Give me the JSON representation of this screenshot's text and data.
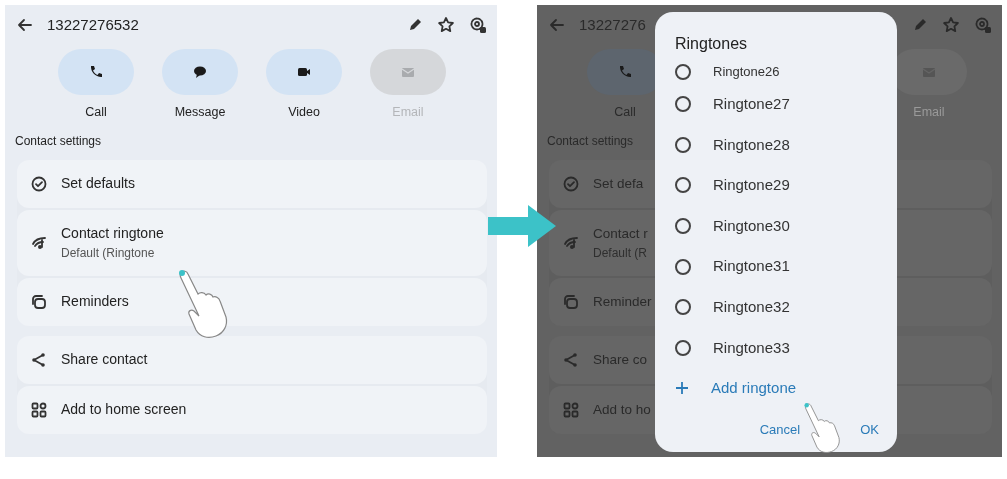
{
  "before_screen": {
    "header": {
      "title": "13227276532"
    },
    "actions": [
      {
        "kind": "call",
        "label": "Call",
        "disabled": false
      },
      {
        "kind": "message",
        "label": "Message",
        "disabled": false
      },
      {
        "kind": "video",
        "label": "Video",
        "disabled": false
      },
      {
        "kind": "email",
        "label": "Email",
        "disabled": true
      }
    ],
    "section_title": "Contact settings",
    "groups": [
      [
        {
          "kind": "defaults",
          "label": "Set defaults"
        },
        {
          "kind": "ringtone",
          "label": "Contact ringtone",
          "sublabel": "Default (Ringtone"
        },
        {
          "kind": "reminders",
          "label": "Reminders"
        }
      ],
      [
        {
          "kind": "share",
          "label": "Share contact"
        },
        {
          "kind": "home",
          "label": "Add to home screen"
        }
      ]
    ]
  },
  "after_screen": {
    "header": {
      "title": "13227276"
    },
    "actions": [
      {
        "kind": "call",
        "label": "Call",
        "disabled": false
      },
      {
        "kind": "email",
        "label": "Email",
        "disabled": true
      }
    ],
    "section_title": "Contact settings",
    "groups": [
      [
        {
          "kind": "defaults",
          "label": "Set defa"
        },
        {
          "kind": "ringtone",
          "label": "Contact r",
          "sublabel": "Default (R"
        },
        {
          "kind": "reminders",
          "label": "Reminder"
        }
      ],
      [
        {
          "kind": "share",
          "label": "Share co"
        },
        {
          "kind": "home",
          "label": "Add to ho"
        }
      ]
    ],
    "dialog": {
      "title": "Ringtones",
      "options": [
        {
          "label": "Ringtone26",
          "selected": false
        },
        {
          "label": "Ringtone27",
          "selected": false
        },
        {
          "label": "Ringtone28",
          "selected": false
        },
        {
          "label": "Ringtone29",
          "selected": false
        },
        {
          "label": "Ringtone30",
          "selected": false
        },
        {
          "label": "Ringtone31",
          "selected": false
        },
        {
          "label": "Ringtone32",
          "selected": false
        },
        {
          "label": "Ringtone33",
          "selected": false
        }
      ],
      "add_label": "Add ringtone",
      "buttons": [
        "Cancel",
        "OK"
      ]
    }
  }
}
